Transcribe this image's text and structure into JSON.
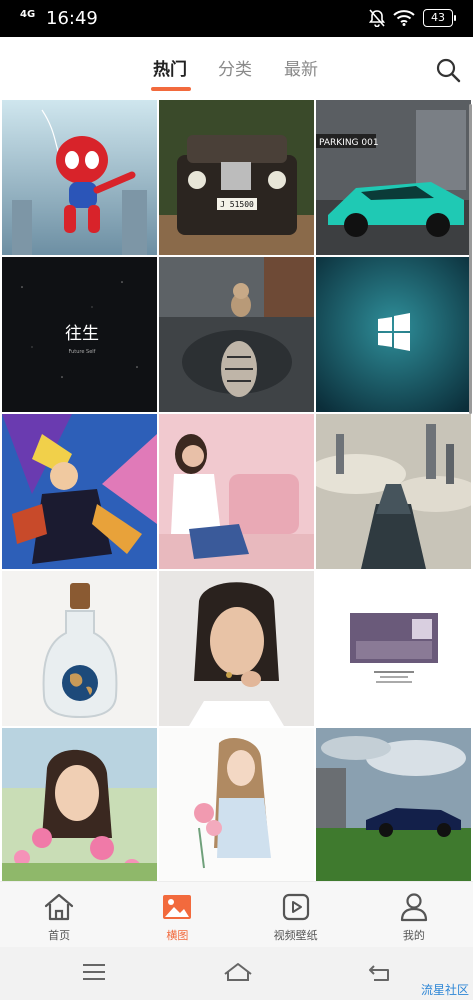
{
  "status_bar": {
    "network": "4G",
    "time": "16:49",
    "battery": "43"
  },
  "tabs": [
    {
      "label": "热门",
      "active": true
    },
    {
      "label": "分类",
      "active": false
    },
    {
      "label": "最新",
      "active": false
    }
  ],
  "grid": {
    "images": [
      {
        "subject": "spider-man-chibi"
      },
      {
        "subject": "vintage-car",
        "plate": "J 51500"
      },
      {
        "subject": "teal-sports-car",
        "sign": "PARKING 001"
      },
      {
        "subject": "dark-text-wallpaper",
        "text": "往生",
        "subtext": "Future Self"
      },
      {
        "subject": "kitten-tiger-reflection"
      },
      {
        "subject": "windows-logo-blue"
      },
      {
        "subject": "game-hero-art"
      },
      {
        "subject": "woman-pink-room"
      },
      {
        "subject": "city-above-clouds"
      },
      {
        "subject": "earth-in-bottle"
      },
      {
        "subject": "woman-portrait"
      },
      {
        "subject": "interior-photo-poster"
      },
      {
        "subject": "girl-with-flowers"
      },
      {
        "subject": "illustrated-girl-roses"
      },
      {
        "subject": "blue-supercar"
      }
    ]
  },
  "bottom_nav": [
    {
      "label": "首页",
      "icon": "home-icon",
      "active": false
    },
    {
      "label": "横图",
      "icon": "image-icon",
      "active": true
    },
    {
      "label": "视频壁纸",
      "icon": "video-play-icon",
      "active": false
    },
    {
      "label": "我的",
      "icon": "user-icon",
      "active": false
    }
  ],
  "watermark": "流星社区",
  "colors": {
    "accent": "#f26a3d",
    "status_bar": "#000000",
    "bottom_nav_bg": "#f7f7f7"
  }
}
